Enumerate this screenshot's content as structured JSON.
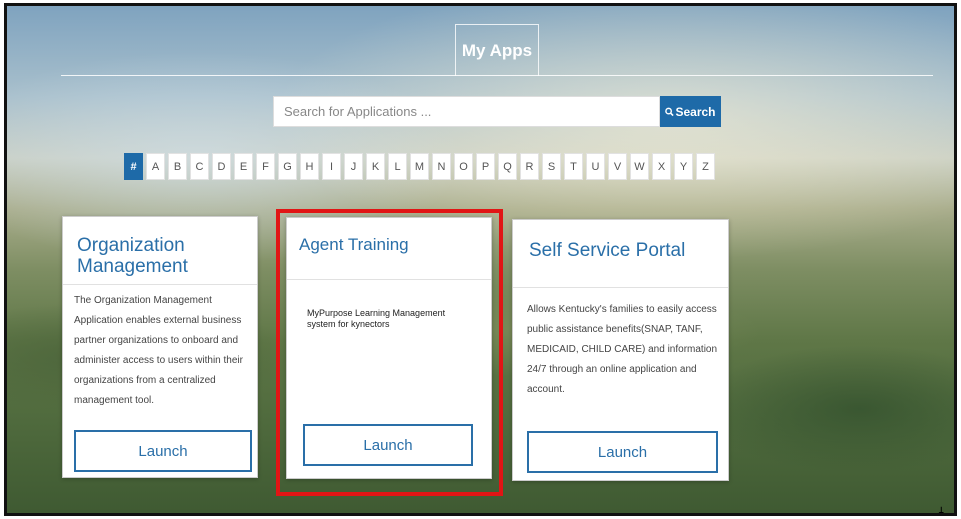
{
  "header": {
    "title": "My Apps"
  },
  "search": {
    "placeholder": "Search for Applications ...",
    "button_label": "Search",
    "icon": "magnifier-icon"
  },
  "alphabet": [
    "#",
    "A",
    "B",
    "C",
    "D",
    "E",
    "F",
    "G",
    "H",
    "I",
    "J",
    "K",
    "L",
    "M",
    "N",
    "O",
    "P",
    "Q",
    "R",
    "S",
    "T",
    "U",
    "V",
    "W",
    "X",
    "Y",
    "Z"
  ],
  "active_letter": "#",
  "cards": [
    {
      "title": "Organization Management",
      "description": "The Organization Management Application enables external business partner organizations to onboard and administer access to users within their organizations from a centralized management tool.",
      "launch_label": "Launch"
    },
    {
      "title": "Agent Training",
      "description": "MyPurpose Learning Management system for kynectors",
      "launch_label": "Launch"
    },
    {
      "title": "Self Service Portal",
      "description": "Allows Kentucky's families to easily access public assistance benefits(SNAP, TANF, MEDICAID, CHILD CARE) and information 24/7 through an online application and account.",
      "launch_label": "Launch"
    }
  ],
  "colors": {
    "accent": "#1e6aa8",
    "highlight": "#e11515"
  }
}
